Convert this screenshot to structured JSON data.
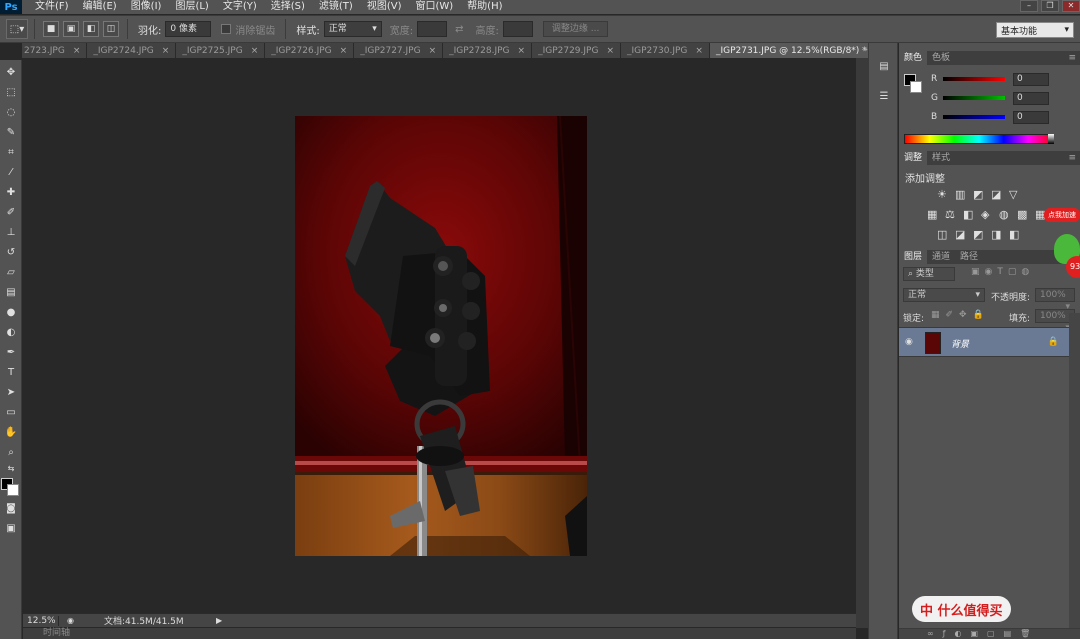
{
  "app": {
    "logo": "Ps"
  },
  "menu": [
    "文件(F)",
    "编辑(E)",
    "图像(I)",
    "图层(L)",
    "文字(Y)",
    "选择(S)",
    "滤镜(T)",
    "视图(V)",
    "窗口(W)",
    "帮助(H)"
  ],
  "options": {
    "feather_label": "羽化:",
    "feather_value": "0 像素",
    "antialias_label": "消除锯齿",
    "style_label": "样式:",
    "style_value": "正常",
    "width_label": "宽度:",
    "height_label": "高度:",
    "refine_edge": "调整边缘 ...",
    "workspace": "基本功能"
  },
  "tabs": [
    {
      "label": "2723.JPG",
      "active": false
    },
    {
      "label": "_IGP2724.JPG",
      "active": false
    },
    {
      "label": "_IGP2725.JPG",
      "active": false
    },
    {
      "label": "_IGP2726.JPG",
      "active": false
    },
    {
      "label": "_IGP2727.JPG",
      "active": false
    },
    {
      "label": "_IGP2728.JPG",
      "active": false
    },
    {
      "label": "_IGP2729.JPG",
      "active": false
    },
    {
      "label": "_IGP2730.JPG",
      "active": false
    },
    {
      "label": "_IGP2731.JPG @ 12.5%(RGB/8*) *",
      "active": true
    }
  ],
  "tab_close": "×",
  "tabs_more": "»",
  "status": {
    "zoom": "12.5%",
    "doc": "文档:41.5M/41.5M",
    "timeline": "时间轴"
  },
  "color_panel": {
    "tabs": [
      "颜色",
      "色板"
    ],
    "channels": [
      {
        "label": "R",
        "value": "0",
        "color": "#ff0000"
      },
      {
        "label": "G",
        "value": "0",
        "color": "#00c000"
      },
      {
        "label": "B",
        "value": "0",
        "color": "#0000ff"
      }
    ]
  },
  "adjust_panel": {
    "tabs": [
      "调整",
      "样式"
    ],
    "title": "添加调整"
  },
  "layers_panel": {
    "tabs": [
      "图层",
      "通道",
      "路径"
    ],
    "kind_filter": "类型",
    "blend_mode": "正常",
    "opacity_label": "不透明度:",
    "opacity_value": "100%",
    "lock_label": "锁定:",
    "fill_label": "填充:",
    "fill_value": "100%",
    "layer_name": "背景"
  },
  "watermark": {
    "text": "中 什么值得买",
    "sticker_top": "点我加速",
    "sticker_num": "93"
  }
}
